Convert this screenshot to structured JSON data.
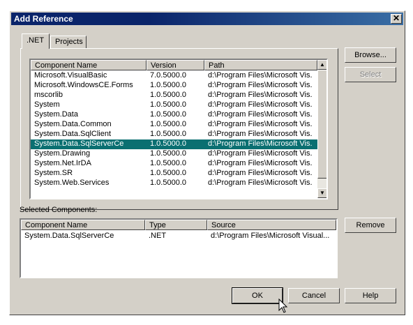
{
  "window": {
    "title": "Add Reference",
    "close_glyph": "✕"
  },
  "tabs": [
    {
      "label": ".NET"
    },
    {
      "label": "Projects"
    }
  ],
  "component_list": {
    "headers": [
      "Component Name",
      "Version",
      "Path"
    ],
    "rows": [
      [
        "Microsoft.VisualBasic",
        "7.0.5000.0",
        "d:\\Program Files\\Microsoft Vis..."
      ],
      [
        "Microsoft.WindowsCE.Forms",
        "1.0.5000.0",
        "d:\\Program Files\\Microsoft Vis..."
      ],
      [
        "mscorlib",
        "1.0.5000.0",
        "d:\\Program Files\\Microsoft Vis..."
      ],
      [
        "System",
        "1.0.5000.0",
        "d:\\Program Files\\Microsoft Vis..."
      ],
      [
        "System.Data",
        "1.0.5000.0",
        "d:\\Program Files\\Microsoft Vis..."
      ],
      [
        "System.Data.Common",
        "1.0.5000.0",
        "d:\\Program Files\\Microsoft Vis..."
      ],
      [
        "System.Data.SqlClient",
        "1.0.5000.0",
        "d:\\Program Files\\Microsoft Vis..."
      ],
      [
        "System.Data.SqlServerCe",
        "1.0.5000.0",
        "d:\\Program Files\\Microsoft Vis..."
      ],
      [
        "System.Drawing",
        "1.0.5000.0",
        "d:\\Program Files\\Microsoft Vis..."
      ],
      [
        "System.Net.IrDA",
        "1.0.5000.0",
        "d:\\Program Files\\Microsoft Vis..."
      ],
      [
        "System.SR",
        "1.0.5000.0",
        "d:\\Program Files\\Microsoft Vis..."
      ],
      [
        "System.Web.Services",
        "1.0.5000.0",
        "d:\\Program Files\\Microsoft Vis..."
      ]
    ],
    "selected_row": "System.Data.SqlServerCe",
    "scroll_up_glyph": "▲",
    "scroll_down_glyph": "▼"
  },
  "side_buttons": {
    "browse": "Browse...",
    "select": "Select",
    "remove": "Remove"
  },
  "selected_components": {
    "label": "Selected Components:",
    "headers": [
      "Component Name",
      "Type",
      "Source"
    ],
    "rows": [
      [
        "System.Data.SqlServerCe",
        ".NET",
        "d:\\Program Files\\Microsoft Visual..."
      ]
    ]
  },
  "footer_buttons": {
    "ok": "OK",
    "cancel": "Cancel",
    "help": "Help"
  },
  "colors": {
    "selection": "#0a6f71",
    "titlebar": "#0a246a",
    "face": "#d4d0c8"
  }
}
